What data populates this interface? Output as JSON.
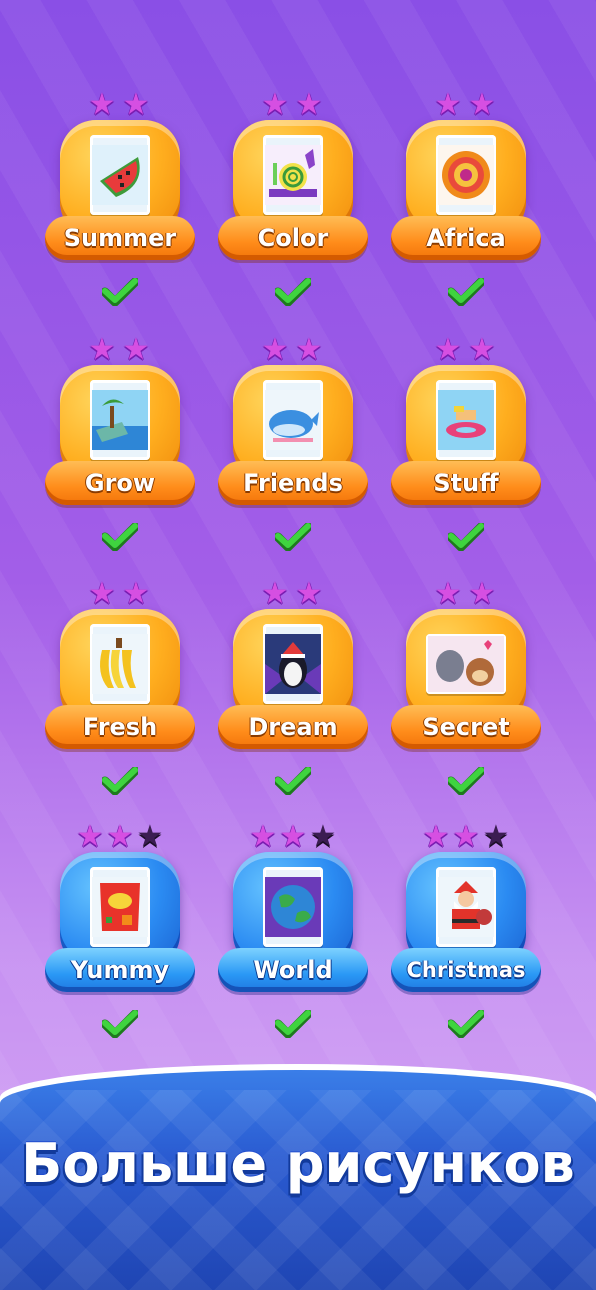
{
  "levels": [
    {
      "name": "Summer",
      "stars": 2,
      "total_stars": 2,
      "theme": "orange",
      "icon": "watermelon",
      "completed": true
    },
    {
      "name": "Color",
      "stars": 2,
      "total_stars": 2,
      "theme": "orange",
      "icon": "snail",
      "completed": true
    },
    {
      "name": "Africa",
      "stars": 2,
      "total_stars": 2,
      "theme": "orange",
      "icon": "flower",
      "completed": true
    },
    {
      "name": "Grow",
      "stars": 2,
      "total_stars": 2,
      "theme": "orange",
      "icon": "palm-island",
      "completed": true
    },
    {
      "name": "Friends",
      "stars": 2,
      "total_stars": 2,
      "theme": "orange",
      "icon": "whale",
      "completed": true
    },
    {
      "name": "Stuff",
      "stars": 2,
      "total_stars": 2,
      "theme": "orange",
      "icon": "floating-girl",
      "completed": true
    },
    {
      "name": "Fresh",
      "stars": 2,
      "total_stars": 2,
      "theme": "orange",
      "icon": "bananas",
      "completed": true
    },
    {
      "name": "Dream",
      "stars": 2,
      "total_stars": 2,
      "theme": "orange",
      "icon": "penguin",
      "completed": true
    },
    {
      "name": "Secret",
      "stars": 2,
      "total_stars": 2,
      "theme": "orange",
      "icon": "dogs",
      "completed": true
    },
    {
      "name": "Yummy",
      "stars": 2,
      "total_stars": 3,
      "theme": "blue",
      "icon": "chips",
      "completed": true
    },
    {
      "name": "World",
      "stars": 2,
      "total_stars": 3,
      "theme": "blue",
      "icon": "globe",
      "completed": true
    },
    {
      "name": "Christmas",
      "stars": 2,
      "total_stars": 3,
      "theme": "blue",
      "icon": "santa",
      "completed": true
    }
  ],
  "banner": {
    "title": "Больше рисунков"
  },
  "colors": {
    "orange": "#ff8c1a",
    "blue": "#2a98f5",
    "check": "#2fbf2f",
    "star": "#d64fe2"
  }
}
